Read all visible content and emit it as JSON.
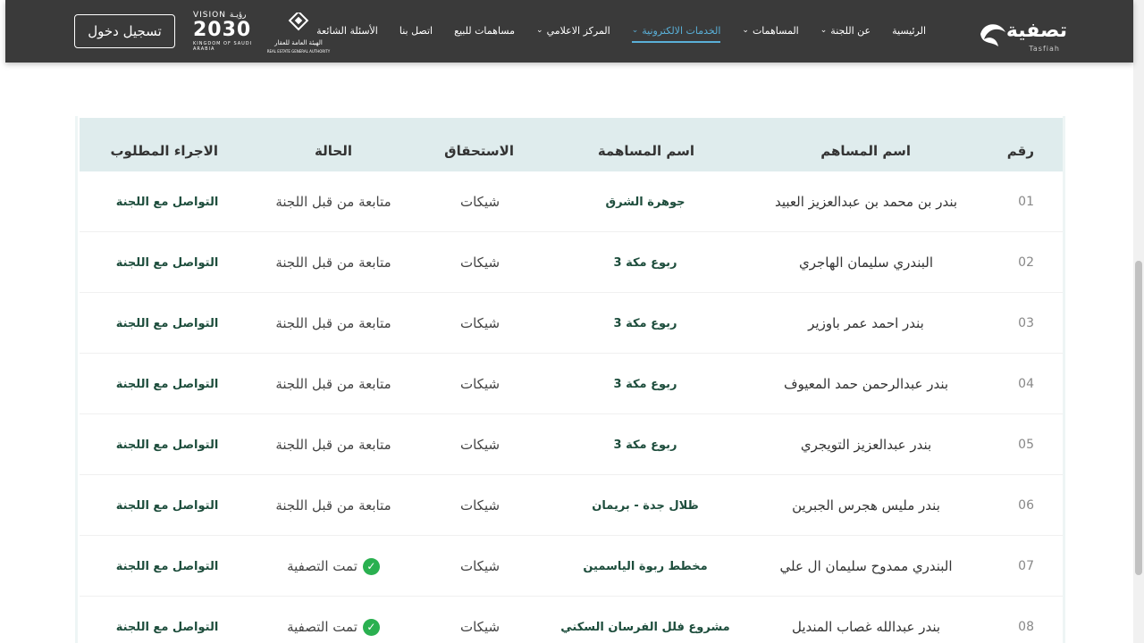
{
  "nav": {
    "logo_text": "تصفية",
    "logo_sub": "Tasfiah",
    "items": [
      {
        "label": "الرئيسية",
        "has_dropdown": false,
        "active": false
      },
      {
        "label": "عن اللجنة",
        "has_dropdown": true,
        "active": false
      },
      {
        "label": "المساهمات",
        "has_dropdown": true,
        "active": false
      },
      {
        "label": "الخدمات الالكترونية",
        "has_dropdown": true,
        "active": true
      },
      {
        "label": "المركز الاعلامي",
        "has_dropdown": true,
        "active": false
      },
      {
        "label": "مساهمات للبيع",
        "has_dropdown": false,
        "active": false
      },
      {
        "label": "اتصل بنا",
        "has_dropdown": false,
        "active": false
      },
      {
        "label": "الأسئلة الشائعة",
        "has_dropdown": false,
        "active": false
      }
    ],
    "rega_ar": "الهيئة العامة للعقار",
    "rega_en": "REAL ESTATE GENERAL AUTHORITY",
    "vision_top": "VISION رؤيـة",
    "vision_year": "2030",
    "vision_bottom": "KINGDOM OF SAUDI ARABIA",
    "login_label": "تسجيل دخول"
  },
  "table": {
    "headers": {
      "num": "رقم",
      "name": "اسم المساهم",
      "project": "اسم المساهمة",
      "due": "الاستحقاق",
      "status": "الحالة",
      "action": "الاجراء المطلوب"
    },
    "rows": [
      {
        "num": "01",
        "name": "بندر بن محمد بن عبدالعزيز العبيد",
        "project": "جوهرة الشرق",
        "due": "شيكات",
        "status": "متابعة من قبل اللجنة",
        "done": false,
        "action": "التواصل مع اللجنة"
      },
      {
        "num": "02",
        "name": "البندري سليمان الهاجري",
        "project": "ربوع مكة 3",
        "due": "شيكات",
        "status": "متابعة من قبل اللجنة",
        "done": false,
        "action": "التواصل مع اللجنة"
      },
      {
        "num": "03",
        "name": "بندر احمد عمر باوزير",
        "project": "ربوع مكة 3",
        "due": "شيكات",
        "status": "متابعة من قبل اللجنة",
        "done": false,
        "action": "التواصل مع اللجنة"
      },
      {
        "num": "04",
        "name": "بندر عبدالرحمن حمد المعيوف",
        "project": "ربوع مكة 3",
        "due": "شيكات",
        "status": "متابعة من قبل اللجنة",
        "done": false,
        "action": "التواصل مع اللجنة"
      },
      {
        "num": "05",
        "name": "بندر عبدالعزيز التويجري",
        "project": "ربوع مكة 3",
        "due": "شيكات",
        "status": "متابعة من قبل اللجنة",
        "done": false,
        "action": "التواصل مع اللجنة"
      },
      {
        "num": "06",
        "name": "بندر مليس هجرس الجبرين",
        "project": "ظلال جدة - بريمان",
        "due": "شيكات",
        "status": "متابعة من قبل اللجنة",
        "done": false,
        "action": "التواصل مع اللجنة"
      },
      {
        "num": "07",
        "name": "البندري ممدوح سليمان ال علي",
        "project": "مخطط ربوة الياسمين",
        "due": "شيكات",
        "status": "تمت التصفية",
        "done": true,
        "action": "التواصل مع اللجنة"
      },
      {
        "num": "08",
        "name": "بندر عبدالله غصاب المنديل",
        "project": "مشروع فلل الفرسان السكني",
        "due": "شيكات",
        "status": "تمت التصفية",
        "done": true,
        "action": "التواصل مع اللجنة"
      }
    ]
  },
  "colors": {
    "navbar_bg": "#3a3a3a",
    "active_nav": "#5ab0d8",
    "header_bg": "#dfeced",
    "project_text": "#1d4d3c",
    "check_green": "#2ab050"
  }
}
